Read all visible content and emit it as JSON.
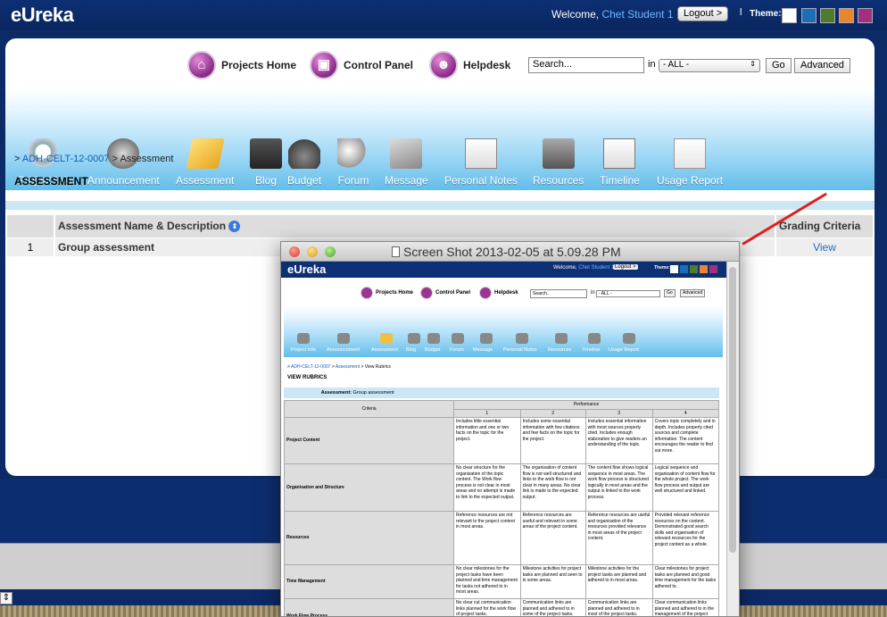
{
  "app": {
    "logo": "eUreka"
  },
  "top": {
    "welcome_prefix": "Welcome, ",
    "user": "Chet Student 1",
    "logout": "Logout >",
    "separator": "l",
    "theme_label": "Theme:",
    "theme_colors": [
      "#ffffff",
      "#1d6fb4",
      "#4f7b2a",
      "#e8862e",
      "#a3307f"
    ]
  },
  "quick_links": [
    {
      "label": "Projects Home",
      "icon": "home-icon"
    },
    {
      "label": "Control Panel",
      "icon": "control-panel-icon"
    },
    {
      "label": "Helpdesk",
      "icon": "helpdesk-icon"
    }
  ],
  "search": {
    "value": "Search...",
    "in_label": "in",
    "scope": "- ALL -",
    "go": "Go",
    "advanced": "Advanced"
  },
  "nav": [
    {
      "label": "Project Info",
      "icon": "magnifier-icon"
    },
    {
      "label": "Announcement",
      "icon": "speaker-icon"
    },
    {
      "label": "Assessment",
      "icon": "folder-icon"
    },
    {
      "label": "Blog",
      "icon": "blog-icon"
    },
    {
      "label": "Budget",
      "icon": "moneybag-icon"
    },
    {
      "label": "Forum",
      "icon": "forum-icon"
    },
    {
      "label": "Message",
      "icon": "envelope-icon"
    },
    {
      "label": "Personal Notes",
      "icon": "notes-icon"
    },
    {
      "label": "Resources",
      "icon": "resources-icon"
    },
    {
      "label": "Timeline",
      "icon": "calendar-icon"
    },
    {
      "label": "Usage Report",
      "icon": "chart-icon"
    }
  ],
  "breadcrumb": {
    "prefix": ">",
    "project": "ADH-CELT-12-0007",
    "sep": ">",
    "current": "Assessment"
  },
  "page_title": "ASSESSMENT",
  "table": {
    "col_name": "Assessment Name & Description",
    "col_grading": "Grading Criteria",
    "rows": [
      {
        "num": "1",
        "name": "Group assessment",
        "action": "View"
      }
    ]
  },
  "overlay": {
    "window_title": "Screen Shot 2013-02-05 at 5.09.28 PM",
    "logo": "eUreka",
    "welcome": "Welcome,",
    "user": "Chet Student 1",
    "logout": "Logout >",
    "theme": "Theme:",
    "quick_links": [
      "Projects Home",
      "Control Panel",
      "Helpdesk"
    ],
    "search": "Search..",
    "in_label": "in",
    "scope": "- ALL -",
    "go": "Go",
    "advanced": "Advanced",
    "nav": [
      "Project Info",
      "Announcement",
      "Assessment",
      "Blog",
      "Budget",
      "Forum",
      "Message",
      "Personal Notes",
      "Resources",
      "Timeline",
      "Usage Report"
    ],
    "breadcrumb": {
      "prefix": ">",
      "project": "ADH-CELT-12-0007",
      "sep1": ">",
      "assessment": "Assessment",
      "sep2": ">",
      "current": "View Rubrics"
    },
    "title": "VIEW RUBRICS",
    "assessment_label": "Assessment:",
    "assessment_value": "Group assessment",
    "rubric": {
      "criteria_header": "Criteria",
      "performance_header": "Performance",
      "levels": [
        "1",
        "2",
        "3",
        "4"
      ],
      "rows": [
        {
          "criteria": "Project Content",
          "cells": [
            "Includes little essential information and one or two facts on the topic for the project.",
            "Includes some essential information with few citations and few facts on the topic for the project.",
            "Includes essential information with most sources properly cited. Includes enough elaboration to give readers an understanding of the topic.",
            "Covers topic completely and in depth. Includes properly cited sources and complete information. The content encourages the reader to find out more."
          ]
        },
        {
          "criteria": "Organisation and Structure",
          "cells": [
            "No clear structure for the organisation of the topic content. The Work flow process is not clear in most areas and no attempt is made to link to the expected output.",
            "The organisation of content flow is not well structured and links to the work flow is not clear in many areas. No clear link is made to the expected output.",
            "The content flow shows logical sequence in most areas. The work flow process is structured logically in most areas and the output is linked to the work process.",
            "Logical sequence and organisation of content flow for the whole project. The work flow process and output are well structured and linked."
          ]
        },
        {
          "criteria": "Resources",
          "cells": [
            "Reference resources are not relevant to the project content in most areas.",
            "Reference resources are useful and relevant in some areas of the project content.",
            "Reference resources are useful and organisation of the resources provided relevance in most areas of the project content.",
            "Provided relevant reference resources on the content. Demonstrated good search skills and organisation of relevant resources for the project content as a whole."
          ]
        },
        {
          "criteria": "Time Management",
          "cells": [
            "No clear milestones for the project tasks have been planned and time management for tasks not adhered to in most areas.",
            "Milestone activities for project tasks are planned and seen to in some areas.",
            "Milestone activities for the project tasks are planned and adhered to in most areas.",
            "Clear milestones for project tasks are planned and good time management for the tasks adhered to."
          ]
        },
        {
          "criteria": "Work Flow Process",
          "cells": [
            "No clear cut communication links planned for the work flow of project tasks.",
            "Communication links are planned and adhered to in some of the project tasks.",
            "Communication links are planned and adhered to in most of the project tasks.",
            "Clear communication links planned and adhered to in the management of the project tasks."
          ]
        }
      ]
    }
  }
}
